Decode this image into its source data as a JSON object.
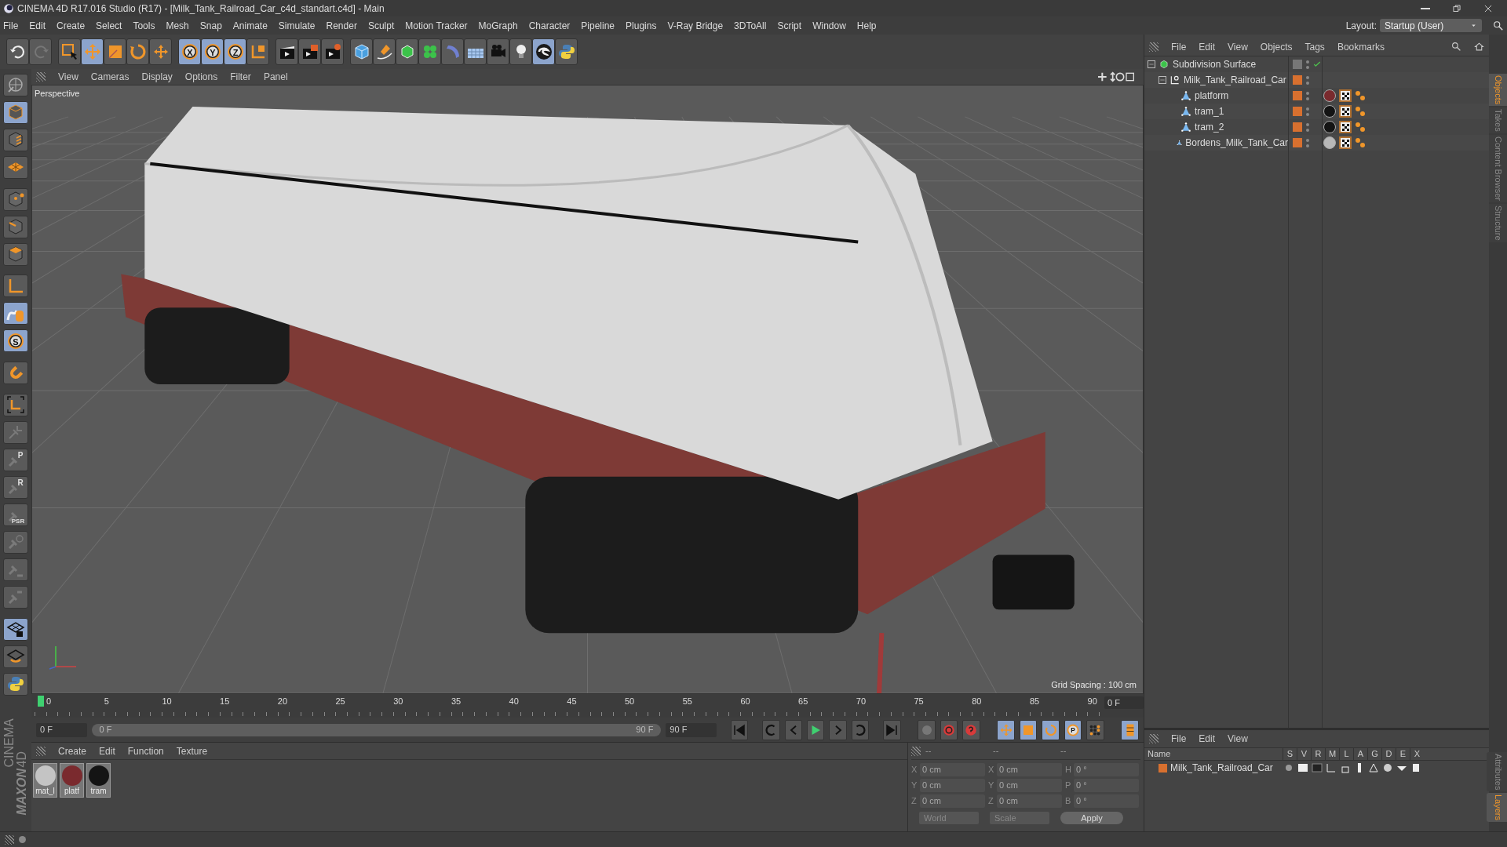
{
  "window": {
    "title": "CINEMA 4D R17.016 Studio (R17) - [Milk_Tank_Railroad_Car_c4d_standart.c4d] - Main"
  },
  "menu_bar": [
    "File",
    "Edit",
    "Create",
    "Select",
    "Tools",
    "Mesh",
    "Snap",
    "Animate",
    "Simulate",
    "Render",
    "Sculpt",
    "Motion Tracker",
    "MoGraph",
    "Character",
    "Pipeline",
    "Plugins",
    "V-Ray Bridge",
    "3DToAll",
    "Script",
    "Window",
    "Help"
  ],
  "layout": {
    "label": "Layout:",
    "value": "Startup (User)"
  },
  "main_toolbar": [
    {
      "active": false
    },
    {
      "active": false
    },
    {
      "active": false
    },
    {
      "active": true
    },
    {
      "active": false
    },
    {
      "active": false
    },
    {
      "active": false
    },
    {
      "active": true,
      "label": "X"
    },
    {
      "active": true,
      "label": "Y"
    },
    {
      "active": true,
      "label": "Z"
    },
    {
      "active": false
    },
    {
      "active": false
    },
    {
      "active": false
    },
    {
      "active": false
    },
    {
      "active": false
    },
    {
      "active": false
    },
    {
      "active": false
    },
    {
      "active": false
    },
    {
      "active": false
    },
    {
      "active": false
    },
    {
      "active": false
    },
    {
      "active": false
    },
    {
      "active": true
    },
    {
      "active": false
    }
  ],
  "left_toolbar": [
    {
      "active": false
    },
    {
      "active": true
    },
    {
      "active": false
    },
    {
      "active": false
    },
    {
      "active": false
    },
    {
      "active": false
    },
    {
      "active": false
    },
    {
      "active": false
    },
    {
      "active": true
    },
    {
      "active": true,
      "label": "S"
    },
    {
      "active": false
    },
    {
      "active": false
    },
    {
      "active": false
    },
    {
      "active": false,
      "label": "P"
    },
    {
      "active": false,
      "label": "R"
    },
    {
      "active": false,
      "label": "PSR"
    },
    {
      "active": false
    },
    {
      "active": false
    },
    {
      "active": false
    },
    {
      "active": true
    },
    {
      "active": false
    },
    {
      "active": false
    }
  ],
  "viewport": {
    "menu": [
      "View",
      "Cameras",
      "Display",
      "Options",
      "Filter",
      "Panel"
    ],
    "camera": "Perspective",
    "grid_spacing": "Grid Spacing : 100 cm"
  },
  "object_manager": {
    "menu": [
      "File",
      "Edit",
      "View",
      "Objects",
      "Tags",
      "Bookmarks"
    ],
    "objects": [
      {
        "name": "Subdivision Surface",
        "kind": "generator",
        "enabled": true,
        "expanded": true,
        "children": [
          {
            "name": "Milk_Tank_Railroad_Car",
            "kind": "null",
            "layer": {
              "color": "#d8702f"
            },
            "expanded": true,
            "children": [
              {
                "name": "platform",
                "kind": "polygon",
                "layer": {
                  "color": "#d8702f"
                },
                "material": {
                  "color": "#7a2a2e"
                }
              },
              {
                "name": "tram_1",
                "kind": "polygon",
                "layer": {
                  "color": "#d8702f"
                },
                "material": {
                  "color": "#141414"
                }
              },
              {
                "name": "tram_2",
                "kind": "polygon",
                "layer": {
                  "color": "#d8702f"
                },
                "material": {
                  "color": "#141414"
                }
              },
              {
                "name": "Bordens_Milk_Tank_Car",
                "kind": "polygon",
                "layer": {
                  "color": "#d8702f"
                },
                "material": {
                  "color": "#b8b8b8"
                }
              }
            ]
          }
        ]
      }
    ]
  },
  "side_tabs": [
    {
      "label": "Objects",
      "selected": true
    },
    {
      "label": "Takes",
      "selected": false
    },
    {
      "label": "Content Browser",
      "selected": false
    },
    {
      "label": "Structure",
      "selected": false
    }
  ],
  "timeline": {
    "ticks": [
      "0",
      "5",
      "10",
      "15",
      "20",
      "25",
      "30",
      "35",
      "40",
      "45",
      "50",
      "55",
      "60",
      "65",
      "70",
      "75",
      "80",
      "85",
      "90"
    ],
    "level": 0,
    "current": "0 F",
    "start": "0 F",
    "range_slider": {
      "start": "0 F",
      "end": "90 F",
      "level": 1
    },
    "end": "90 F"
  },
  "key_toolbar": [
    {
      "active": true
    },
    {
      "active": true
    },
    {
      "active": true
    },
    {
      "active": true,
      "label": "P"
    },
    {
      "active": false
    }
  ],
  "material_manager": {
    "menu": [
      "Create",
      "Edit",
      "Function",
      "Texture"
    ],
    "materials": [
      {
        "name": "mat_l",
        "color": "#c4c4c4"
      },
      {
        "name": "platf",
        "color": "#7a2a2e"
      },
      {
        "name": "tram",
        "color": "#141414"
      }
    ]
  },
  "logo": {
    "brand": "MAXON",
    "product": "CINEMA 4D"
  },
  "coordinates": {
    "headers": [
      "--",
      "--",
      "--"
    ],
    "columns": [
      [
        {
          "label": "X",
          "value": "0 cm"
        },
        {
          "label": "Y",
          "value": "0 cm"
        },
        {
          "label": "Z",
          "value": "0 cm"
        }
      ],
      [
        {
          "label": "X",
          "value": "0 cm"
        },
        {
          "label": "Y",
          "value": "0 cm"
        },
        {
          "label": "Z",
          "value": "0 cm"
        }
      ],
      [
        {
          "label": "H",
          "value": "0 °"
        },
        {
          "label": "P",
          "value": "0 °"
        },
        {
          "label": "B",
          "value": "0 °"
        }
      ]
    ],
    "mode": "World",
    "size_mode": "Scale",
    "apply": "Apply"
  },
  "layer_manager": {
    "menu": [
      "File",
      "Edit",
      "View"
    ],
    "columns": [
      "Name",
      "S",
      "V",
      "R",
      "M",
      "L",
      "A",
      "G",
      "D",
      "E",
      "X"
    ],
    "layers": [
      {
        "name": "Milk_Tank_Railroad_Car",
        "color": "#d8702f"
      }
    ]
  },
  "bottom_tabs": [
    {
      "label": "Attributes",
      "selected": false
    },
    {
      "label": "Layers",
      "selected": true
    }
  ]
}
